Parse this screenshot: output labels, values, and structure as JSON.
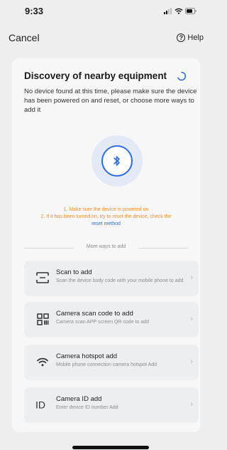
{
  "status_bar": {
    "time": "9:33"
  },
  "nav": {
    "cancel": "Cancel",
    "help": "Help"
  },
  "card": {
    "title": "Discovery of nearby equipment",
    "description": "No device found at this time, please make sure the device has been powered on and reset, or choose more ways to add it",
    "hint_1": "1. Make sure the device is powered on",
    "hint_2": "2. If it has been turned on, try to reset the device, check the",
    "reset_link": "reset method",
    "divider_label": "More ways to add",
    "options": [
      {
        "title": "Scan to add",
        "subtitle": "Scan the device body code with your mobile phone to add",
        "icon": "scan-icon"
      },
      {
        "title": "Camera scan code to add",
        "subtitle": "Camera scan APP screen QR code to add",
        "icon": "qr-code-icon"
      },
      {
        "title": "Camera hotspot add",
        "subtitle": "Mobile phone connection camera hotspot Add",
        "icon": "wifi-icon"
      },
      {
        "title": "Camera ID add",
        "subtitle": "Enter device ID number Add",
        "icon": "id-icon"
      }
    ]
  },
  "colors": {
    "accent_blue": "#2f6bd8",
    "hint_orange": "#f08c2e"
  }
}
